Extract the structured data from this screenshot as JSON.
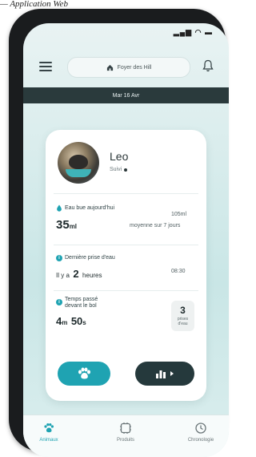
{
  "page_fragment": {
    "underlined": "",
    "text": "— Application Web"
  },
  "status_bar": {
    "icons": [
      "signal-icon",
      "wifi-icon",
      "battery-icon"
    ]
  },
  "header": {
    "home_label": "Foyer des Hill"
  },
  "date_bar": {
    "text": "Mar 16 Avr"
  },
  "pet": {
    "name": "Leo",
    "status": "Suivi"
  },
  "water": {
    "label": "Eau bue aujourd'hui",
    "value": "35",
    "unit": "ml",
    "avg_value": "105ml",
    "avg_label": "moyenne sur 7 jours"
  },
  "last_drink": {
    "label": "Dernière prise d'eau",
    "prefix": "Il y a",
    "value": "2",
    "unit": "heures",
    "time": "08:30"
  },
  "bowl_time": {
    "label_line1": "Temps passé",
    "label_line2": "devant le bol",
    "minutes": "4",
    "min_unit": "m",
    "seconds": "50",
    "sec_unit": "s",
    "drinks_count": "3",
    "drinks_label_line1": "prises",
    "drinks_label_line2": "d'eau"
  },
  "nav": {
    "items": [
      {
        "label": "Animaux",
        "icon": "pet-icon",
        "active": true
      },
      {
        "label": "Produits",
        "icon": "product-icon",
        "active": false
      },
      {
        "label": "Chronologie",
        "icon": "history-icon",
        "active": false
      }
    ]
  },
  "colors": {
    "accent": "#1fa3b2",
    "dark": "#25393c",
    "date_bar": "#2a3a3c"
  }
}
